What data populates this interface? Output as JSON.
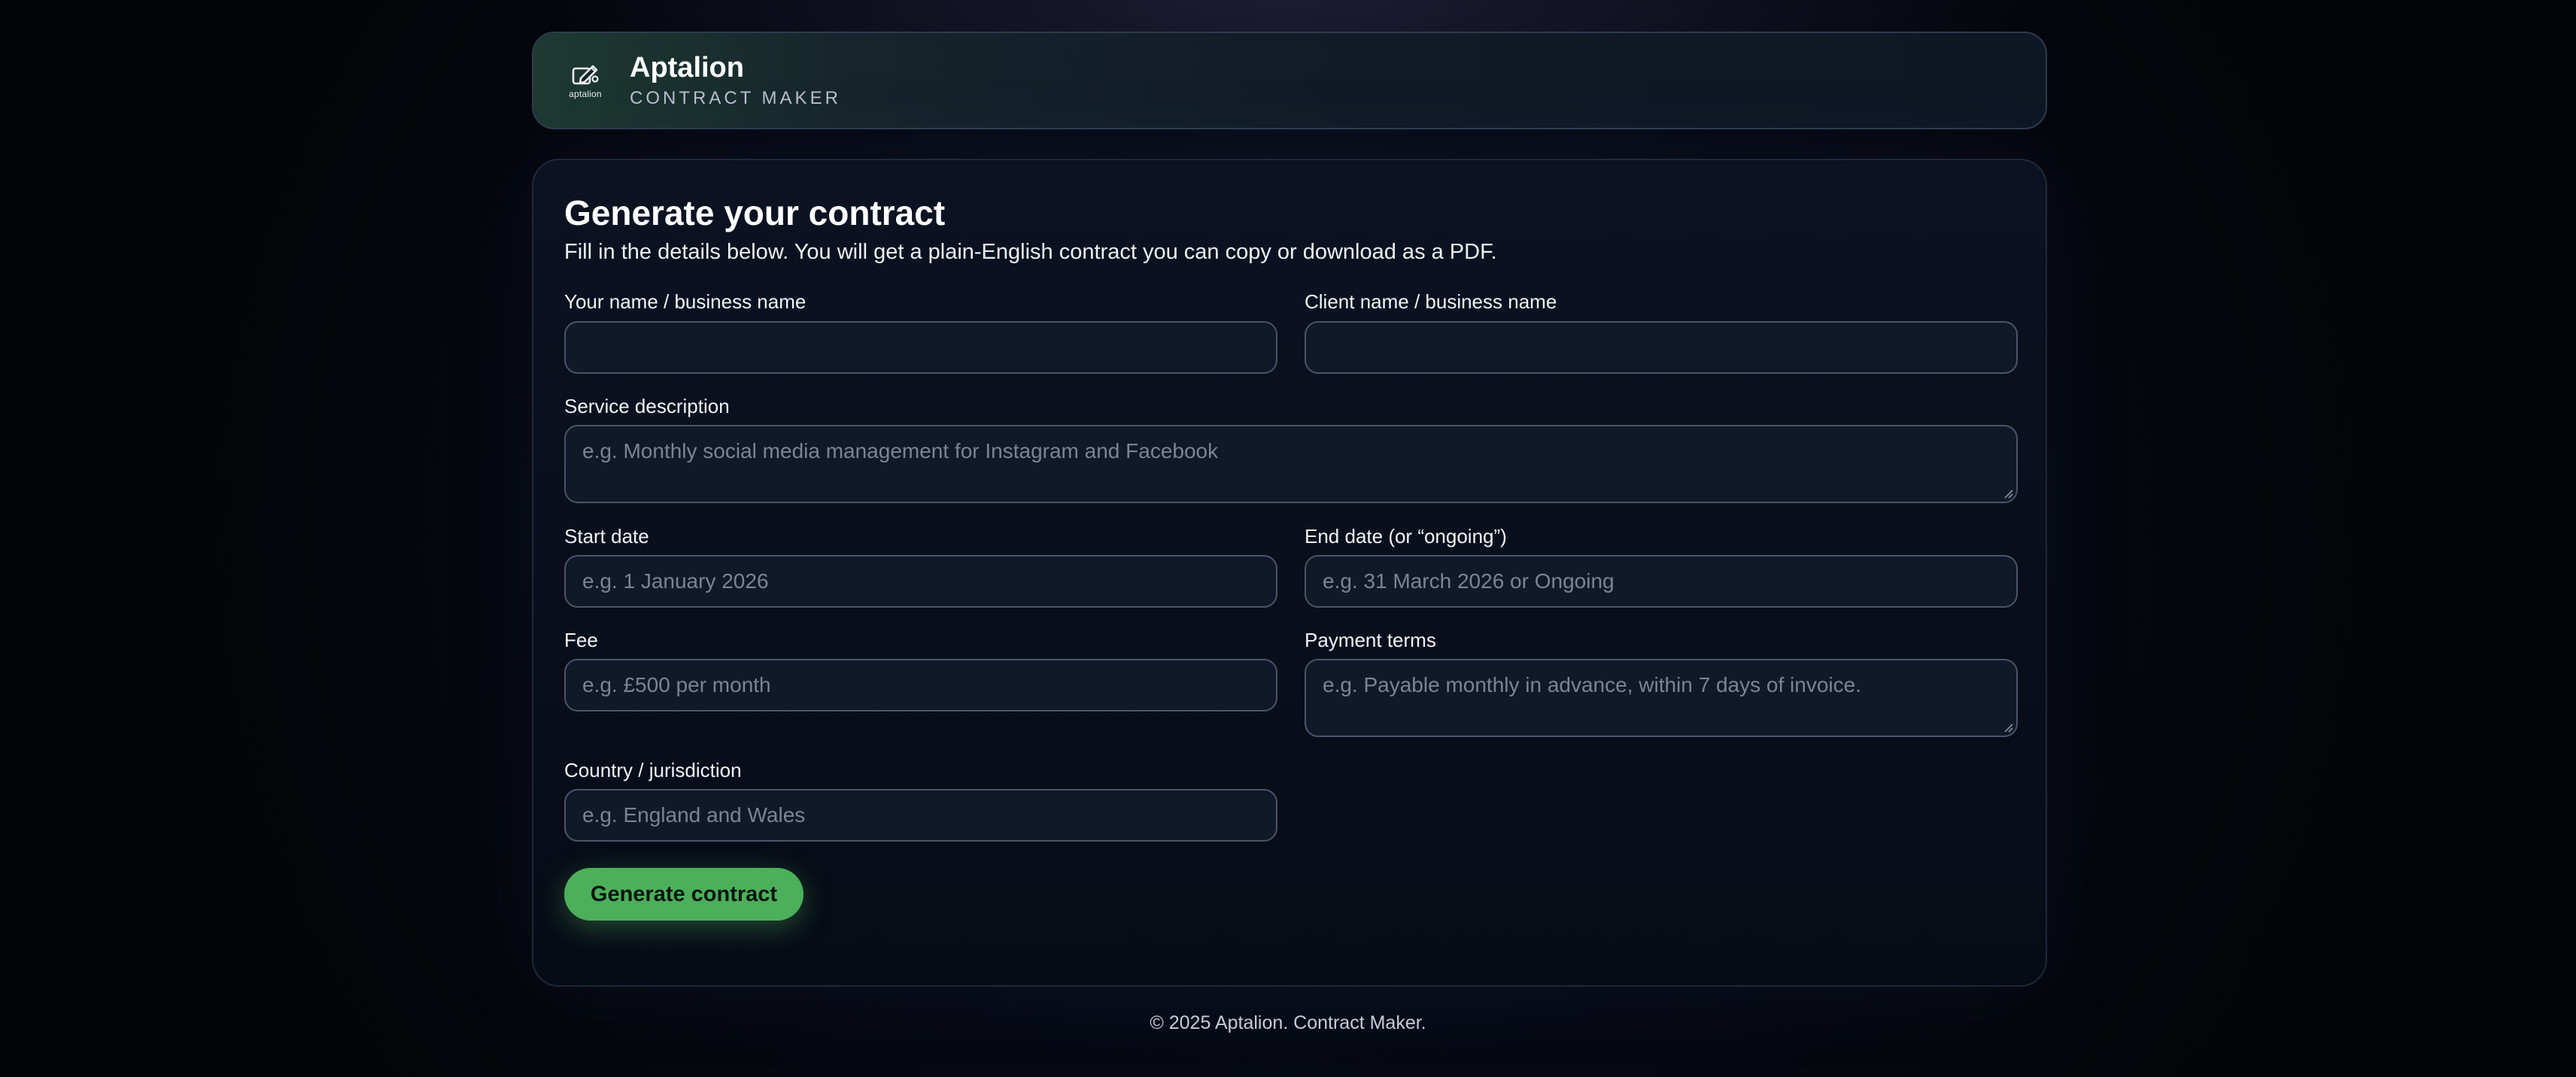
{
  "header": {
    "logo_word": "aptalion",
    "brand_name": "Aptalion",
    "tagline": "CONTRACT MAKER"
  },
  "form": {
    "title": "Generate your contract",
    "subtitle": "Fill in the details below. You will get a plain-English contract you can copy or download as a PDF.",
    "your_name": {
      "label": "Your name / business name",
      "value": "",
      "placeholder": ""
    },
    "client_name": {
      "label": "Client name / business name",
      "value": "",
      "placeholder": ""
    },
    "service": {
      "label": "Service description",
      "value": "",
      "placeholder": "e.g. Monthly social media management for Instagram and Facebook"
    },
    "start_date": {
      "label": "Start date",
      "value": "",
      "placeholder": "e.g. 1 January 2026"
    },
    "end_date": {
      "label": "End date (or “ongoing”)",
      "value": "",
      "placeholder": "e.g. 31 March 2026 or Ongoing"
    },
    "fee": {
      "label": "Fee",
      "value": "",
      "placeholder": "e.g. £500 per month"
    },
    "payment_terms": {
      "label": "Payment terms",
      "value": "",
      "placeholder": "e.g. Payable monthly in advance, within 7 days of invoice."
    },
    "country": {
      "label": "Country / jurisdiction",
      "value": "",
      "placeholder": "e.g. England and Wales"
    },
    "submit_label": "Generate contract"
  },
  "footer": {
    "text": "© 2025 Aptalion. Contract Maker."
  },
  "colors": {
    "accent_green": "#4caf5a",
    "background": "#060913",
    "field_background": "#111829",
    "field_border": "#4b5468"
  }
}
